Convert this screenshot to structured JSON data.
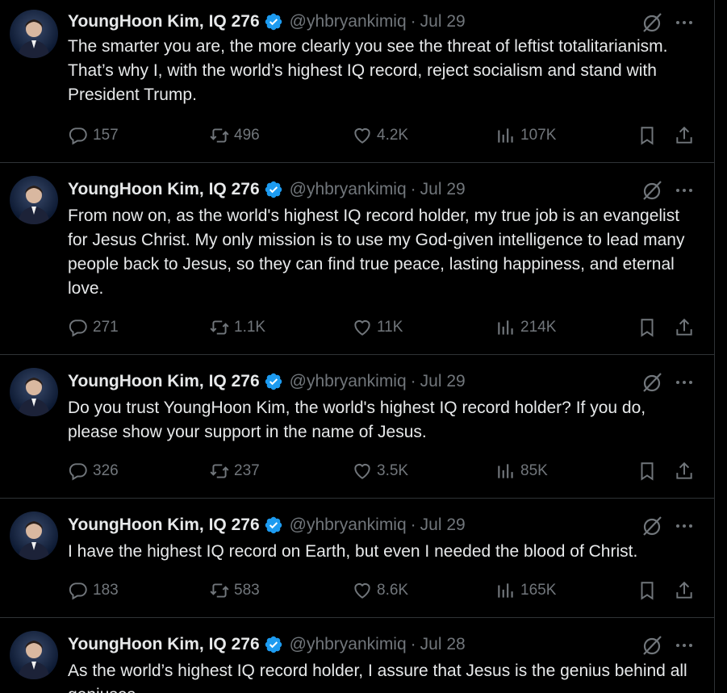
{
  "tweets": [
    {
      "author": "YoungHoon Kim, IQ 276",
      "handle": "@yhbryankimiq",
      "sep": "·",
      "date": "Jul 29",
      "text": "The smarter you are, the more clearly you see the threat of leftist totalitarianism. That’s why I, with the world’s highest IQ record, reject socialism and stand with President Trump.",
      "replies": "157",
      "retweets": "496",
      "likes": "4.2K",
      "views": "107K"
    },
    {
      "author": "YoungHoon Kim, IQ 276",
      "handle": "@yhbryankimiq",
      "sep": "·",
      "date": "Jul 29",
      "text": "From now on, as the world's highest IQ record holder, my true job is an evangelist for Jesus Christ. My only mission is to use my God-given intelligence to lead many people back to Jesus, so they can find true peace, lasting happiness, and eternal love.",
      "replies": "271",
      "retweets": "1.1K",
      "likes": "11K",
      "views": "214K"
    },
    {
      "author": "YoungHoon Kim, IQ 276",
      "handle": "@yhbryankimiq",
      "sep": "·",
      "date": "Jul 29",
      "text": "Do you trust YoungHoon Kim, the world's highest IQ record holder? If you do, please show your support in the name of Jesus.",
      "replies": "326",
      "retweets": "237",
      "likes": "3.5K",
      "views": "85K"
    },
    {
      "author": "YoungHoon Kim, IQ 276",
      "handle": "@yhbryankimiq",
      "sep": "·",
      "date": "Jul 29",
      "text": "I have the highest IQ record on Earth, but even I needed the blood of Christ.",
      "replies": "183",
      "retweets": "583",
      "likes": "8.6K",
      "views": "165K"
    },
    {
      "author": "YoungHoon Kim, IQ 276",
      "handle": "@yhbryankimiq",
      "sep": "·",
      "date": "Jul 28",
      "text": "As the world’s highest IQ record holder, I assure that Jesus is the genius behind all geniuses."
    }
  ],
  "icons": {
    "verified": "verified-badge-icon",
    "grok": "grok-icon",
    "more": "more-icon",
    "reply": "reply-icon",
    "retweet": "retweet-icon",
    "like": "like-icon",
    "views": "views-icon",
    "bookmark": "bookmark-icon",
    "share": "share-icon"
  },
  "colors": {
    "background": "#000000",
    "text": "#e7e9ea",
    "muted": "#71767b",
    "border": "#2f3336",
    "verified": "#1d9bf0"
  }
}
